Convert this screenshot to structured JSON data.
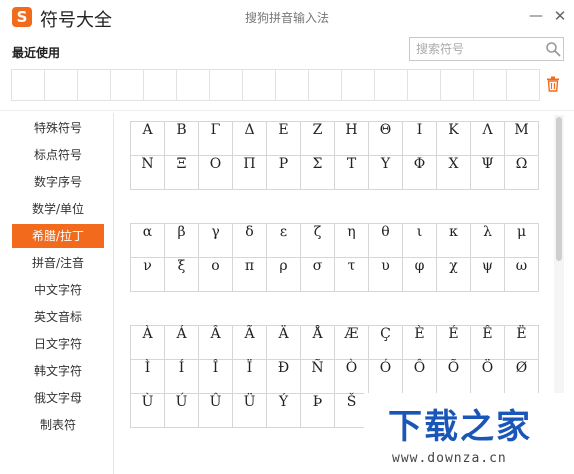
{
  "window": {
    "logo_glyph": "S",
    "title": "符号大全",
    "center_title": "搜狗拼音输入法",
    "minimize_glyph": "—",
    "close_glyph": "✕"
  },
  "recent": {
    "label": "最近使用",
    "cell_count": 16
  },
  "search": {
    "placeholder": "搜索符号",
    "value": ""
  },
  "sidebar": {
    "active_index": 4,
    "accent_color": "#f26b1d",
    "items": [
      {
        "label": "特殊符号"
      },
      {
        "label": "标点符号"
      },
      {
        "label": "数字序号"
      },
      {
        "label": "数学/单位"
      },
      {
        "label": "希腊/拉丁"
      },
      {
        "label": "拼音/注音"
      },
      {
        "label": "中文字符"
      },
      {
        "label": "英文音标"
      },
      {
        "label": "日文字符"
      },
      {
        "label": "韩文字符"
      },
      {
        "label": "俄文字母"
      },
      {
        "label": "制表符"
      }
    ]
  },
  "symbol_groups": [
    {
      "name": "greek-upper",
      "rows": [
        [
          "Α",
          "Β",
          "Γ",
          "Δ",
          "Ε",
          "Ζ",
          "Η",
          "Θ",
          "Ι",
          "Κ",
          "Λ",
          "Μ"
        ],
        [
          "Ν",
          "Ξ",
          "Ο",
          "Π",
          "Ρ",
          "Σ",
          "Τ",
          "Υ",
          "Φ",
          "Χ",
          "Ψ",
          "Ω"
        ]
      ]
    },
    {
      "name": "greek-lower",
      "rows": [
        [
          "α",
          "β",
          "γ",
          "δ",
          "ε",
          "ζ",
          "η",
          "θ",
          "ι",
          "κ",
          "λ",
          "μ"
        ],
        [
          "ν",
          "ξ",
          "ο",
          "π",
          "ρ",
          "σ",
          "τ",
          "υ",
          "φ",
          "χ",
          "ψ",
          "ω"
        ]
      ]
    },
    {
      "name": "latin-accented",
      "rows": [
        [
          "À",
          "Á",
          "Â",
          "Ã",
          "Ä",
          "Å",
          "Æ",
          "Ç",
          "È",
          "É",
          "Ê",
          "Ë"
        ],
        [
          "Ì",
          "Í",
          "Î",
          "Ï",
          "Ð",
          "Ñ",
          "Ò",
          "Ó",
          "Ô",
          "Õ",
          "Ö",
          "Ø"
        ],
        [
          "Ù",
          "Ú",
          "Û",
          "Ü",
          "Ý",
          "Þ",
          "Š",
          "",
          "",
          "",
          "",
          ""
        ]
      ]
    }
  ],
  "watermark": {
    "title": "下载之家",
    "url": "www.downza.cn",
    "color": "#1a56b8"
  }
}
